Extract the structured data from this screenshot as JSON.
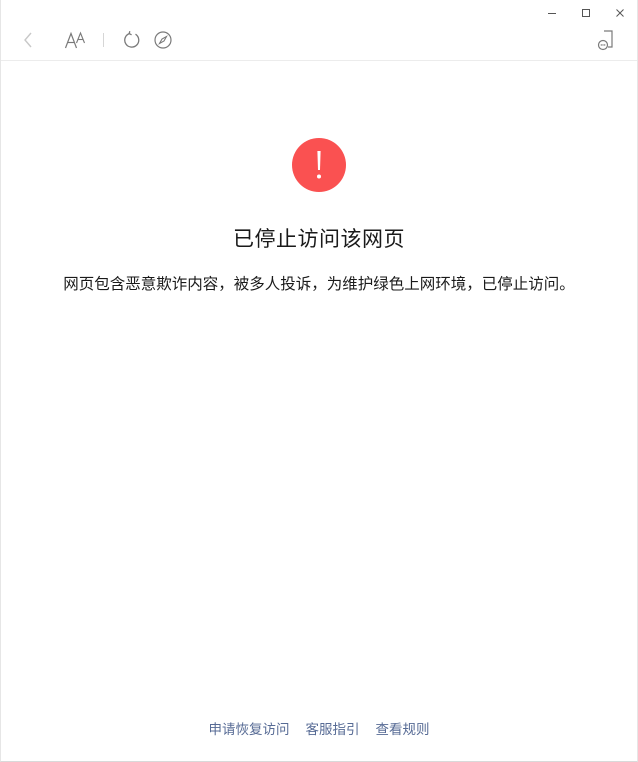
{
  "window": {
    "controls": [
      {
        "name": "minimize-icon"
      },
      {
        "name": "maximize-icon"
      },
      {
        "name": "close-icon"
      }
    ]
  },
  "toolbar": {
    "icons": [
      "back-arrow-icon",
      "font-size-icon",
      "refresh-icon",
      "compass-icon",
      "device-icon"
    ]
  },
  "main": {
    "title": "已停止访问该网页",
    "message": "网页包含恶意欺诈内容，被多人投诉，为维护绿色上网环境，已停止访问。"
  },
  "footer": {
    "links": [
      {
        "label": "申请恢复访问"
      },
      {
        "label": "客服指引"
      },
      {
        "label": "查看规则"
      }
    ]
  },
  "colors": {
    "warning": "#fa5151",
    "link": "#576b95",
    "text": "#1a1a1a",
    "icon": "#8a8a8a"
  }
}
